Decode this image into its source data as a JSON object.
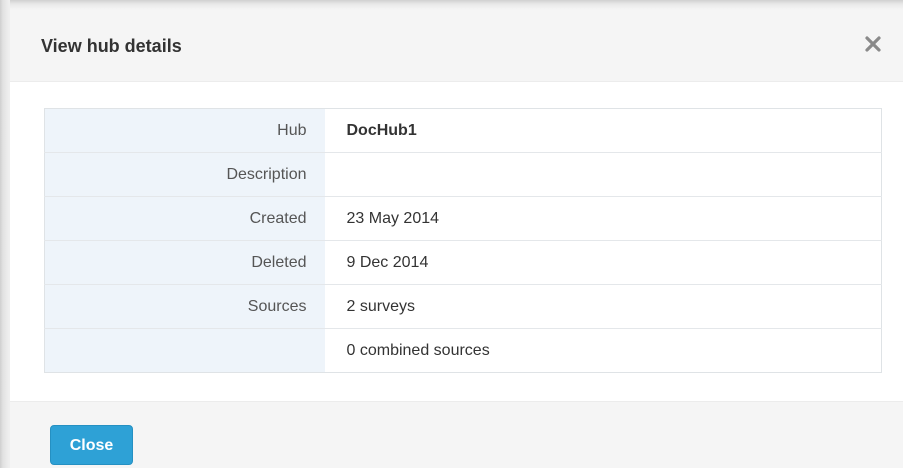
{
  "modal": {
    "title": "View hub details",
    "close_icon": "close-icon"
  },
  "details": [
    {
      "label": "Hub",
      "value": "DocHub1",
      "bold": true
    },
    {
      "label": "Description",
      "value": ""
    },
    {
      "label": "Created",
      "value": "23 May 2014"
    },
    {
      "label": "Deleted",
      "value": "9 Dec 2014"
    },
    {
      "label": "Sources",
      "value": "2 surveys"
    },
    {
      "label": "",
      "value": "0 combined sources"
    }
  ],
  "footer": {
    "close_label": "Close"
  },
  "colors": {
    "accent": "#2ea1d6",
    "label_bg": "#eef4fa",
    "header_bg": "#f5f5f5"
  }
}
